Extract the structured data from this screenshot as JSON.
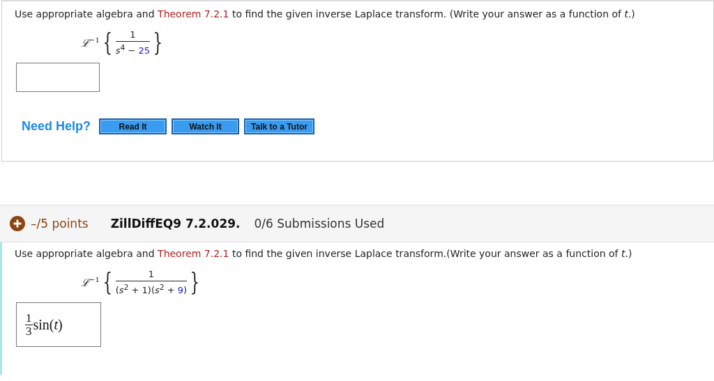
{
  "questions": [
    {
      "prompt_before": "Use appropriate algebra and ",
      "theorem_link": "Theorem 7.2.1",
      "prompt_after": " to find the given inverse Laplace transform. (Write your answer as a function of *t*.)",
      "formula": {
        "operator": "ℒ",
        "operator_power": "−1",
        "open_brace": "{",
        "close_brace": "}",
        "numerator": "1",
        "denominator": [
          {
            "kind": "plain",
            "text": "*s*$^{4}$ − "
          },
          {
            "kind": "value",
            "text": "25"
          }
        ]
      },
      "answer": {
        "kind": "empty"
      },
      "help": {
        "label": "Need Help?",
        "buttons": [
          "Read It",
          "Watch It",
          "Talk to a Tutor"
        ]
      }
    },
    {
      "header": {
        "points": "–/5 points",
        "code": "ZillDiffEQ9 7.2.029.",
        "submissions": "0/6 Submissions Used"
      },
      "prompt_before": "Use appropriate algebra and ",
      "theorem_link": "Theorem 7.2.1",
      "prompt_after": " to find the given inverse Laplace transform.(Write your answer as a function of *t*.)",
      "formula": {
        "operator": "ℒ",
        "operator_power": "−1",
        "open_brace": "{",
        "close_brace": "}",
        "numerator": "1",
        "denominator": [
          {
            "kind": "plain",
            "text": "(*s*$^{2}$ + 1)(*s*$^{2}$ + "
          },
          {
            "kind": "value",
            "text": "9"
          },
          {
            "kind": "plain",
            "text": ")"
          }
        ]
      },
      "answer": {
        "kind": "fraction",
        "numerator": "1",
        "denominator": "3",
        "rest": "sin(*t*)"
      }
    }
  ]
}
